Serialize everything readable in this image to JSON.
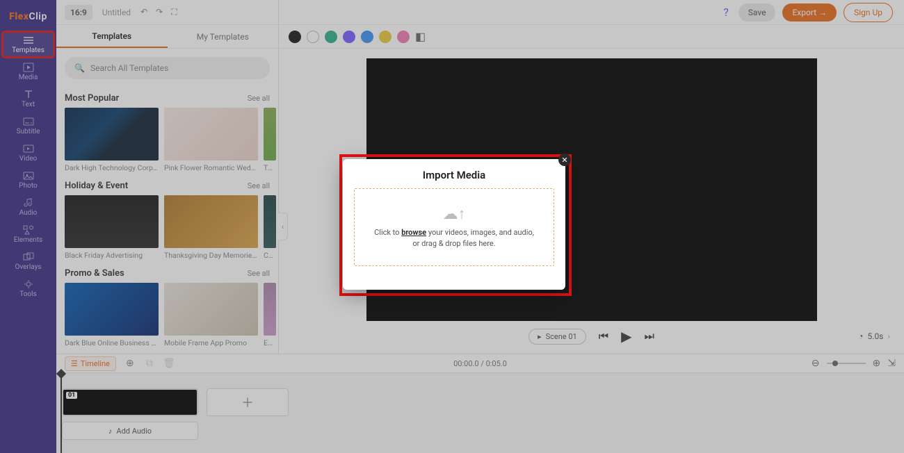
{
  "brand": {
    "a": "Flex",
    "b": "Clip"
  },
  "header": {
    "aspect": "16:9",
    "title": "Untitled",
    "save": "Save",
    "export": "Export",
    "signup": "Sign Up"
  },
  "nav": [
    {
      "id": "templates",
      "label": "Templates",
      "active": true,
      "hilite": true
    },
    {
      "id": "media",
      "label": "Media"
    },
    {
      "id": "text",
      "label": "Text"
    },
    {
      "id": "subtitle",
      "label": "Subtitle"
    },
    {
      "id": "video",
      "label": "Video"
    },
    {
      "id": "photo",
      "label": "Photo"
    },
    {
      "id": "audio",
      "label": "Audio"
    },
    {
      "id": "elements",
      "label": "Elements"
    },
    {
      "id": "overlays",
      "label": "Overlays"
    },
    {
      "id": "tools",
      "label": "Tools"
    }
  ],
  "tabs": {
    "a": "Templates",
    "b": "My Templates"
  },
  "search": {
    "placeholder": "Search All Templates"
  },
  "sections": [
    {
      "title": "Most Popular",
      "see": "See all",
      "items": [
        {
          "cap": "Dark High Technology Corporate...",
          "bg": "linear-gradient(135deg,#0a2a4a,#0e3e6e 40%,#123 60%)"
        },
        {
          "cap": "Pink Flower Romantic Wedding ...",
          "bg": "linear-gradient(135deg,#f6e9e3,#e9d2c8)"
        },
        {
          "cap": "Te...",
          "bg": "linear-gradient(#8a5,#6a4)",
          "cut": true
        }
      ]
    },
    {
      "title": "Holiday & Event",
      "see": "See all",
      "items": [
        {
          "cap": "Black Friday Advertising",
          "bg": "linear-gradient(#1a1a1a,#2a2a2a)"
        },
        {
          "cap": "Thanksgiving Day Memories Fa...",
          "bg": "linear-gradient(135deg,#b07a2a,#d9a24a)"
        },
        {
          "cap": "Cy...",
          "bg": "linear-gradient(#244,#355)",
          "cut": true
        }
      ]
    },
    {
      "title": "Promo & Sales",
      "see": "See all",
      "items": [
        {
          "cap": "Dark Blue Online Business Confe...",
          "bg": "linear-gradient(135deg,#0a5fb3,#0a2a6e)"
        },
        {
          "cap": "Mobile Frame App Promo",
          "bg": "linear-gradient(135deg,#e8e3da,#c9c0b0)"
        },
        {
          "cap": "Ec...",
          "bg": "linear-gradient(#a8a,#c9c)",
          "cut": true
        }
      ]
    }
  ],
  "swatches": [
    "#1a1a1a",
    "#ffffff",
    "#2fb28a",
    "#7a5cff",
    "#3a8ff5",
    "#e9c93a",
    "#ef7bb3"
  ],
  "scene": {
    "label": "Scene 01",
    "dur": "5.0s"
  },
  "timeline": {
    "button": "Timeline",
    "time": "00:00.0 / 0:05.0",
    "sceneNum": "01",
    "addAudio": "Add Audio"
  },
  "modal": {
    "title": "Import Media",
    "pre": "Click to ",
    "link": "browse",
    "post": " your videos, images, and audio, or drag & drop files here."
  }
}
